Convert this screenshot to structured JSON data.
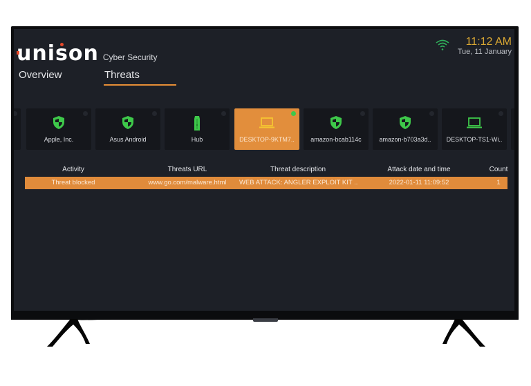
{
  "header": {
    "brand": "unison",
    "subtitle": "Cyber Security",
    "time": "11:12 AM",
    "date": "Tue, 11 January",
    "wifi_icon": "wifi-icon",
    "colors": {
      "accent": "#e88f36",
      "brand_dot": "#e8492a",
      "time": "#d9a733",
      "wifi": "#2fae5a",
      "shield": "#3ec84a"
    }
  },
  "tabs": [
    {
      "label": "Overview",
      "active": false
    },
    {
      "label": "Threats",
      "active": true
    }
  ],
  "devices": [
    {
      "label": "",
      "icon": "shield-icon",
      "selected": false,
      "partial": true
    },
    {
      "label": "Apple, Inc.",
      "icon": "shield-icon",
      "selected": false
    },
    {
      "label": "Asus Android",
      "icon": "shield-icon",
      "selected": false
    },
    {
      "label": "Hub",
      "icon": "hub-icon",
      "selected": false
    },
    {
      "label": "DESKTOP-9KTM7..",
      "icon": "laptop-icon",
      "selected": true
    },
    {
      "label": "amazon-bcab114c",
      "icon": "shield-icon",
      "selected": false
    },
    {
      "label": "amazon-b703a3d..",
      "icon": "shield-icon",
      "selected": false
    },
    {
      "label": "DESKTOP-TS1-Wi..",
      "icon": "laptop-icon",
      "selected": false
    },
    {
      "label": "",
      "icon": "",
      "selected": false,
      "partial": true
    }
  ],
  "table": {
    "columns": [
      "Activity",
      "Threats URL",
      "Threat description",
      "Attack date and time",
      "Count"
    ],
    "rows": [
      [
        "Threat blocked",
        "www.go.com/malware.html",
        "WEB ATTACK: ANGLER EXPLOIT KIT ..",
        "2022-01-11 11:09:52",
        "1"
      ]
    ]
  }
}
